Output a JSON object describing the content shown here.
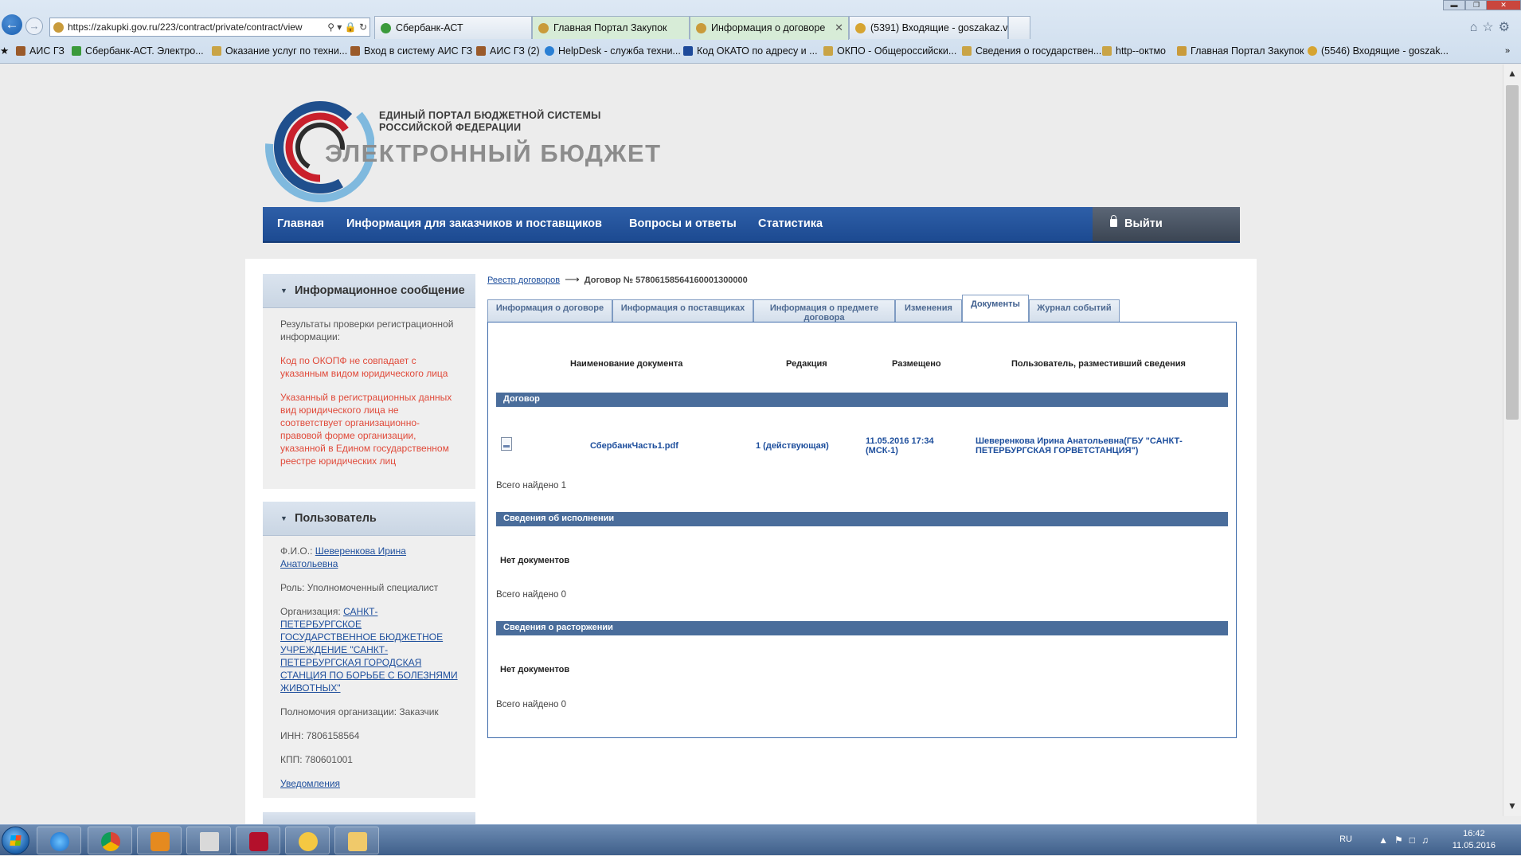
{
  "browser": {
    "address": "https://zakupki.gov.ru/223/contract/private/contract/view",
    "tabs": [
      {
        "label": "Сбербанк-АСТ",
        "color": "#3b9a3b"
      },
      {
        "label": "Главная Портал Закупок",
        "color": "#c99b3b"
      },
      {
        "label": "Информация о договоре",
        "color": "#c99b3b"
      },
      {
        "label": "(5391) Входящие - goszakaz.v...",
        "color": "#d6a431"
      }
    ],
    "bookmarks": [
      "АИС ГЗ",
      "Сбербанк-АСТ. Электро...",
      "Оказание услуг по техни...",
      "Вход в систему  АИС ГЗ",
      "АИС ГЗ (2)",
      "HelpDesk - служба техни...",
      "Код ОКАТО по адресу и ...",
      "ОКПО - Общероссийски...",
      "Сведения о государствен...",
      "http--октмо",
      "Главная Портал Закупок",
      "(5546) Входящие - goszak..."
    ]
  },
  "brand": {
    "line1": "ЕДИНЫЙ ПОРТАЛ БЮДЖЕТНОЙ СИСТЕМЫ",
    "line2": "РОССИЙСКОЙ ФЕДЕРАЦИИ",
    "title": "ЭЛЕКТРОННЫЙ БЮДЖЕТ"
  },
  "menu": {
    "items": [
      "Главная",
      "Информация для заказчиков и поставщиков",
      "Вопросы и ответы",
      "Статистика"
    ],
    "logout": "Выйти"
  },
  "info_panel": {
    "title": "Информационное сообщение",
    "intro": "Результаты проверки регистрационной информации:",
    "warnings": [
      "Код по ОКОПФ не совпадает с указанным видом юридического лица",
      "Указанный в регистрационных данных вид юридического лица не соответствует организационно-правовой форме организации, указанной в Едином государственном реестре юридических лиц"
    ]
  },
  "user_panel": {
    "title": "Пользователь",
    "fio_label": "Ф.И.О.:",
    "fio": "Шеверенкова Ирина Анатольевна",
    "role": "Роль: Уполномоченный специалист",
    "org_label": "Организация:",
    "org": "САНКТ-ПЕТЕРБУРГСКОЕ ГОСУДАРСТВЕННОЕ БЮДЖЕТНОЕ УЧРЕЖДЕНИЕ \"САНКТ-ПЕТЕРБУРГСКАЯ ГОРОДСКАЯ СТАНЦИЯ ПО БОРЬБЕ С БОЛЕЗНЯМИ ЖИВОТНЫХ\"",
    "authority": "Полномочия организации: Заказчик",
    "inn": "ИНН: 7806158564",
    "kpp": "КПП: 780601001",
    "notifications": "Уведомления"
  },
  "breadcrumb": {
    "link": "Реестр договоров",
    "current": "Договор № 57806158564160001300000"
  },
  "content_tabs": [
    "Информация о договоре",
    "Информация о поставщиках",
    "Информация о предмете договора",
    "Изменения",
    "Документы",
    "Журнал событий"
  ],
  "documents": {
    "columns": [
      "Наименование документа",
      "Редакция",
      "Размещено",
      "Пользователь, разместивший сведения"
    ],
    "sections": [
      {
        "title": "Договор",
        "rows": [
          {
            "name": "СбербанкЧасть1.pdf",
            "edition": "1 (действующая)",
            "posted": "11.05.2016 17:34 (МСК-1)",
            "user": "Шеверенкова Ирина Анатольевна(ГБУ \"САНКТ-ПЕТЕРБУРГСКАЯ ГОРВЕТСТАНЦИЯ\")"
          }
        ],
        "total": "Всего найдено 1"
      },
      {
        "title": "Сведения об исполнении",
        "empty": "Нет документов",
        "total": "Всего найдено 0"
      },
      {
        "title": "Сведения о расторжении",
        "empty": "Нет документов",
        "total": "Всего найдено 0"
      }
    ]
  },
  "taskbar": {
    "lang": "RU",
    "time": "16:42",
    "date": "11.05.2016"
  }
}
